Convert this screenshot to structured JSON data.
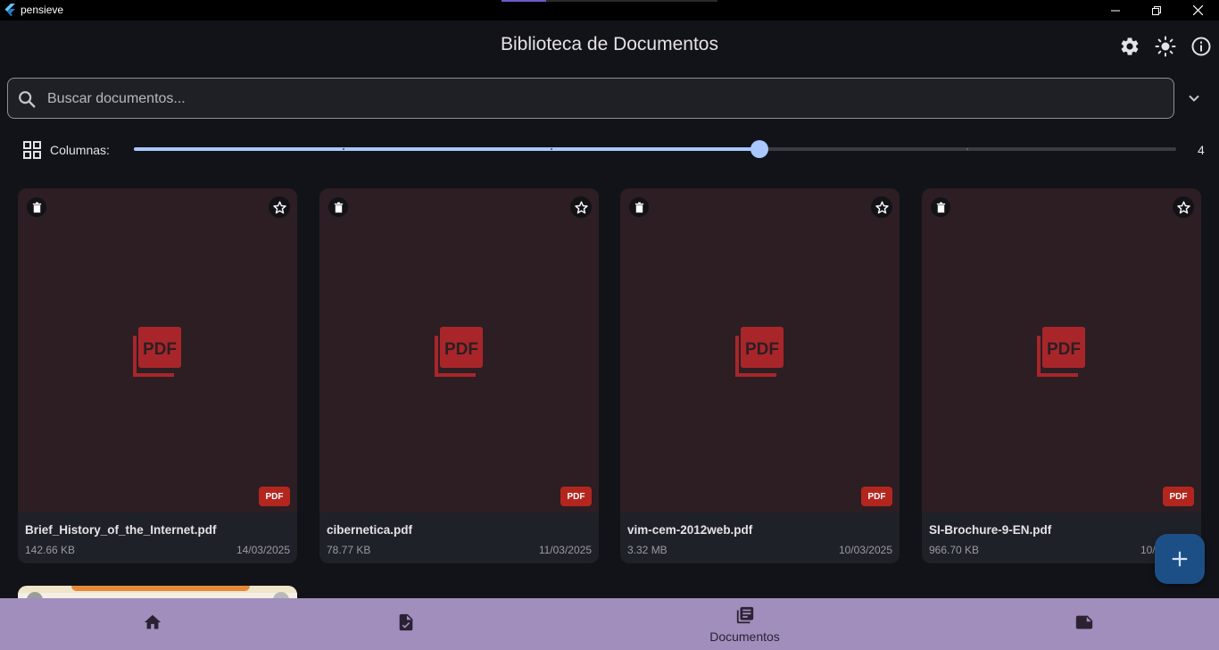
{
  "window": {
    "app_name": "pensieve"
  },
  "header": {
    "title": "Biblioteca de Documentos"
  },
  "search": {
    "placeholder": "Buscar documentos..."
  },
  "columns": {
    "label": "Columnas:",
    "value": "4",
    "slider_fraction": 0.6,
    "max_value": 6
  },
  "documents": [
    {
      "name": "Brief_History_of_the_Internet.pdf",
      "size": "142.66 KB",
      "date": "14/03/2025",
      "badge": "PDF"
    },
    {
      "name": "cibernetica.pdf",
      "size": "78.77 KB",
      "date": "11/03/2025",
      "badge": "PDF"
    },
    {
      "name": "vim-cem-2012web.pdf",
      "size": "3.32 MB",
      "date": "10/03/2025",
      "badge": "PDF"
    },
    {
      "name": "SI-Brochure-9-EN.pdf",
      "size": "966.70 KB",
      "date": "10/03/2025",
      "badge": "PDF"
    }
  ],
  "bottom_nav": {
    "items": [
      {
        "icon": "home-icon",
        "label": ""
      },
      {
        "icon": "task-document-icon",
        "label": ""
      },
      {
        "icon": "library-books-icon",
        "label": "Documentos"
      },
      {
        "icon": "note-icon",
        "label": ""
      }
    ]
  },
  "colors": {
    "background": "#111318",
    "accent": "#a8c8ff",
    "nav_background": "#a18ebd",
    "fab": "#1d4f87",
    "pdf_red": "#b3261e"
  }
}
